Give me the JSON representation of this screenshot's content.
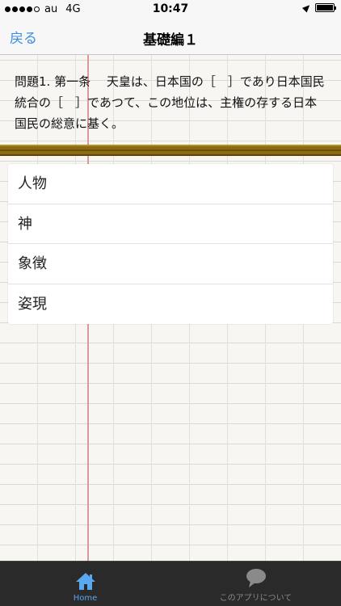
{
  "status_bar": {
    "carrier": "au",
    "network": "4G",
    "time": "10:47",
    "signal_bars": 4
  },
  "nav": {
    "back_label": "戻る",
    "title": "基礎編１"
  },
  "question": {
    "text": "問題1. 第一条　 天皇は、日本国の［　］であり日本国民統合の［　］であつて、この地位は、主権の存する日本国民の総意に基く。"
  },
  "answers": [
    {
      "label": "人物"
    },
    {
      "label": "神"
    },
    {
      "label": "象徴"
    },
    {
      "label": "姿現"
    }
  ],
  "tab_bar": {
    "tabs": [
      {
        "label": "Home",
        "icon": "home-icon",
        "active": true
      },
      {
        "label": "このアプリについて",
        "icon": "speech-bubble-icon",
        "active": false
      }
    ],
    "active_color": "#5aa8ef",
    "inactive_color": "#8a8a8a"
  }
}
